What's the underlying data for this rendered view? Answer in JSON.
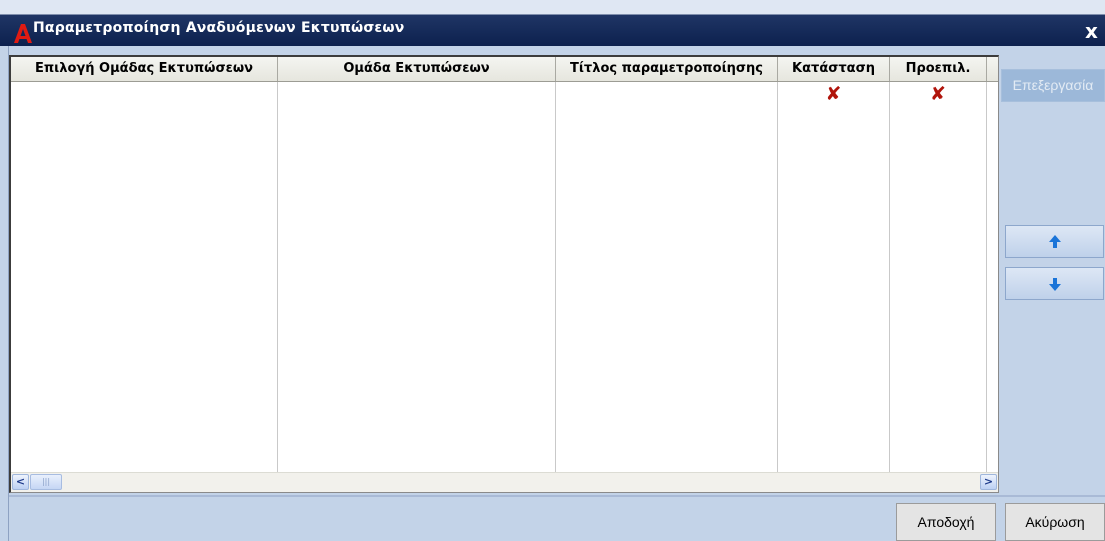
{
  "window": {
    "title": "Παραμετροποίηση Αναδυόμενων Εκτυπώσεων",
    "close_glyph": "x",
    "logo_icon": "app-logo-icon",
    "colors": {
      "titlebar": "#0d214e",
      "background": "#c3d3e8",
      "x_mark": "#b0140b"
    }
  },
  "grid": {
    "columns": [
      {
        "label": "Επιλογή Ομάδας Εκτυπώσεων"
      },
      {
        "label": "Ομάδα Εκτυπώσεων"
      },
      {
        "label": "Τίτλος παραμετροποίησης"
      },
      {
        "label": "Κατάσταση"
      },
      {
        "label": "Προεπιλ."
      }
    ],
    "rows": [
      {
        "cells": [
          "",
          "",
          "",
          "✘",
          "✘"
        ]
      }
    ],
    "scroll_left_glyph": "<",
    "scroll_right_glyph": ">",
    "scroll_thumb_glyph": "|||"
  },
  "side": {
    "edit_label": "Επεξεργασία",
    "move_up_icon": "arrow-up-icon",
    "move_down_icon": "arrow-down-icon"
  },
  "footer": {
    "accept_label": "Αποδοχή",
    "cancel_label": "Ακύρωση"
  }
}
